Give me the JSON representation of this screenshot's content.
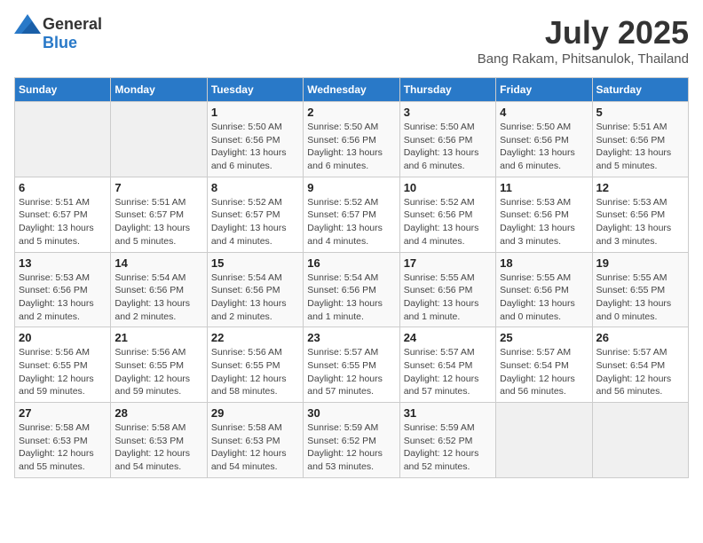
{
  "header": {
    "logo_general": "General",
    "logo_blue": "Blue",
    "month_title": "July 2025",
    "location": "Bang Rakam, Phitsanulok, Thailand"
  },
  "days_of_week": [
    "Sunday",
    "Monday",
    "Tuesday",
    "Wednesday",
    "Thursday",
    "Friday",
    "Saturday"
  ],
  "weeks": [
    [
      {
        "day": "",
        "info": ""
      },
      {
        "day": "",
        "info": ""
      },
      {
        "day": "1",
        "info": "Sunrise: 5:50 AM\nSunset: 6:56 PM\nDaylight: 13 hours\nand 6 minutes."
      },
      {
        "day": "2",
        "info": "Sunrise: 5:50 AM\nSunset: 6:56 PM\nDaylight: 13 hours\nand 6 minutes."
      },
      {
        "day": "3",
        "info": "Sunrise: 5:50 AM\nSunset: 6:56 PM\nDaylight: 13 hours\nand 6 minutes."
      },
      {
        "day": "4",
        "info": "Sunrise: 5:50 AM\nSunset: 6:56 PM\nDaylight: 13 hours\nand 6 minutes."
      },
      {
        "day": "5",
        "info": "Sunrise: 5:51 AM\nSunset: 6:56 PM\nDaylight: 13 hours\nand 5 minutes."
      }
    ],
    [
      {
        "day": "6",
        "info": "Sunrise: 5:51 AM\nSunset: 6:57 PM\nDaylight: 13 hours\nand 5 minutes."
      },
      {
        "day": "7",
        "info": "Sunrise: 5:51 AM\nSunset: 6:57 PM\nDaylight: 13 hours\nand 5 minutes."
      },
      {
        "day": "8",
        "info": "Sunrise: 5:52 AM\nSunset: 6:57 PM\nDaylight: 13 hours\nand 4 minutes."
      },
      {
        "day": "9",
        "info": "Sunrise: 5:52 AM\nSunset: 6:57 PM\nDaylight: 13 hours\nand 4 minutes."
      },
      {
        "day": "10",
        "info": "Sunrise: 5:52 AM\nSunset: 6:56 PM\nDaylight: 13 hours\nand 4 minutes."
      },
      {
        "day": "11",
        "info": "Sunrise: 5:53 AM\nSunset: 6:56 PM\nDaylight: 13 hours\nand 3 minutes."
      },
      {
        "day": "12",
        "info": "Sunrise: 5:53 AM\nSunset: 6:56 PM\nDaylight: 13 hours\nand 3 minutes."
      }
    ],
    [
      {
        "day": "13",
        "info": "Sunrise: 5:53 AM\nSunset: 6:56 PM\nDaylight: 13 hours\nand 2 minutes."
      },
      {
        "day": "14",
        "info": "Sunrise: 5:54 AM\nSunset: 6:56 PM\nDaylight: 13 hours\nand 2 minutes."
      },
      {
        "day": "15",
        "info": "Sunrise: 5:54 AM\nSunset: 6:56 PM\nDaylight: 13 hours\nand 2 minutes."
      },
      {
        "day": "16",
        "info": "Sunrise: 5:54 AM\nSunset: 6:56 PM\nDaylight: 13 hours\nand 1 minute."
      },
      {
        "day": "17",
        "info": "Sunrise: 5:55 AM\nSunset: 6:56 PM\nDaylight: 13 hours\nand 1 minute."
      },
      {
        "day": "18",
        "info": "Sunrise: 5:55 AM\nSunset: 6:56 PM\nDaylight: 13 hours\nand 0 minutes."
      },
      {
        "day": "19",
        "info": "Sunrise: 5:55 AM\nSunset: 6:55 PM\nDaylight: 13 hours\nand 0 minutes."
      }
    ],
    [
      {
        "day": "20",
        "info": "Sunrise: 5:56 AM\nSunset: 6:55 PM\nDaylight: 12 hours\nand 59 minutes."
      },
      {
        "day": "21",
        "info": "Sunrise: 5:56 AM\nSunset: 6:55 PM\nDaylight: 12 hours\nand 59 minutes."
      },
      {
        "day": "22",
        "info": "Sunrise: 5:56 AM\nSunset: 6:55 PM\nDaylight: 12 hours\nand 58 minutes."
      },
      {
        "day": "23",
        "info": "Sunrise: 5:57 AM\nSunset: 6:55 PM\nDaylight: 12 hours\nand 57 minutes."
      },
      {
        "day": "24",
        "info": "Sunrise: 5:57 AM\nSunset: 6:54 PM\nDaylight: 12 hours\nand 57 minutes."
      },
      {
        "day": "25",
        "info": "Sunrise: 5:57 AM\nSunset: 6:54 PM\nDaylight: 12 hours\nand 56 minutes."
      },
      {
        "day": "26",
        "info": "Sunrise: 5:57 AM\nSunset: 6:54 PM\nDaylight: 12 hours\nand 56 minutes."
      }
    ],
    [
      {
        "day": "27",
        "info": "Sunrise: 5:58 AM\nSunset: 6:53 PM\nDaylight: 12 hours\nand 55 minutes."
      },
      {
        "day": "28",
        "info": "Sunrise: 5:58 AM\nSunset: 6:53 PM\nDaylight: 12 hours\nand 54 minutes."
      },
      {
        "day": "29",
        "info": "Sunrise: 5:58 AM\nSunset: 6:53 PM\nDaylight: 12 hours\nand 54 minutes."
      },
      {
        "day": "30",
        "info": "Sunrise: 5:59 AM\nSunset: 6:52 PM\nDaylight: 12 hours\nand 53 minutes."
      },
      {
        "day": "31",
        "info": "Sunrise: 5:59 AM\nSunset: 6:52 PM\nDaylight: 12 hours\nand 52 minutes."
      },
      {
        "day": "",
        "info": ""
      },
      {
        "day": "",
        "info": ""
      }
    ]
  ]
}
